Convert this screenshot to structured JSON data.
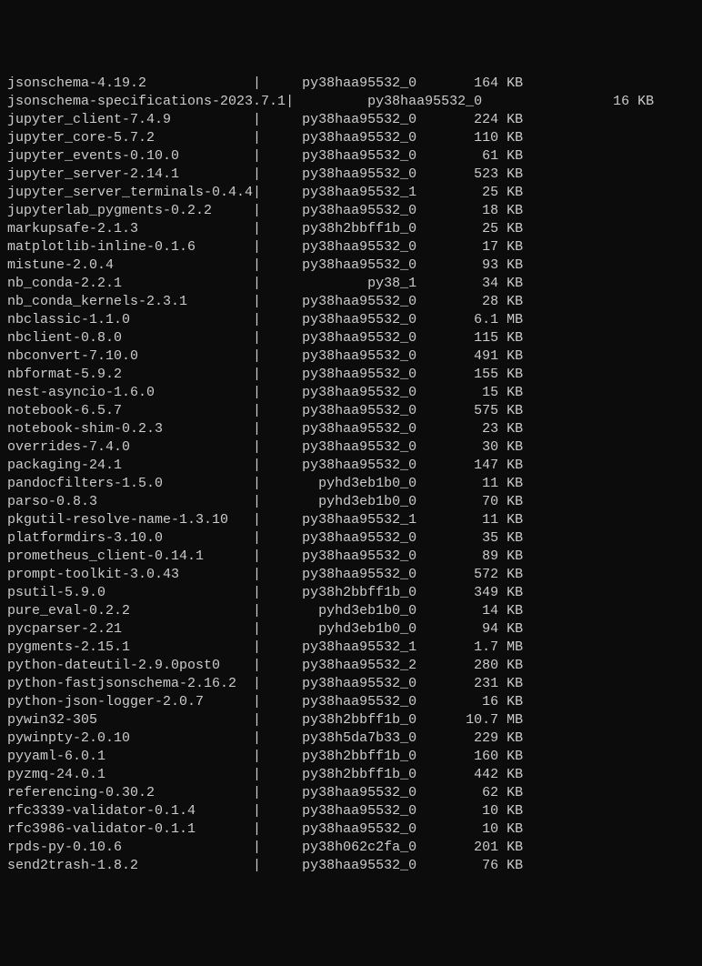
{
  "packages": [
    {
      "name": "jsonschema-4.19.2",
      "separator": "|",
      "build": "py38haa95532_0",
      "size": "164 KB"
    },
    {
      "name": "jsonschema-specifications-2023.7.1",
      "separator": "|",
      "build": "py38haa95532_0",
      "size": "16 KB"
    },
    {
      "name": "jupyter_client-7.4.9",
      "separator": "|",
      "build": "py38haa95532_0",
      "size": "224 KB"
    },
    {
      "name": "jupyter_core-5.7.2",
      "separator": "|",
      "build": "py38haa95532_0",
      "size": "110 KB"
    },
    {
      "name": "jupyter_events-0.10.0",
      "separator": "|",
      "build": "py38haa95532_0",
      "size": "61 KB"
    },
    {
      "name": "jupyter_server-2.14.1",
      "separator": "|",
      "build": "py38haa95532_0",
      "size": "523 KB"
    },
    {
      "name": "jupyter_server_terminals-0.4.4",
      "separator": "|",
      "build": "py38haa95532_1",
      "size": "25 KB"
    },
    {
      "name": "jupyterlab_pygments-0.2.2",
      "separator": "|",
      "build": "py38haa95532_0",
      "size": "18 KB"
    },
    {
      "name": "markupsafe-2.1.3",
      "separator": "|",
      "build": "py38h2bbff1b_0",
      "size": "25 KB"
    },
    {
      "name": "matplotlib-inline-0.1.6",
      "separator": "|",
      "build": "py38haa95532_0",
      "size": "17 KB"
    },
    {
      "name": "mistune-2.0.4",
      "separator": "|",
      "build": "py38haa95532_0",
      "size": "93 KB"
    },
    {
      "name": "nb_conda-2.2.1",
      "separator": "|",
      "build": "py38_1",
      "size": "34 KB"
    },
    {
      "name": "nb_conda_kernels-2.3.1",
      "separator": "|",
      "build": "py38haa95532_0",
      "size": "28 KB"
    },
    {
      "name": "nbclassic-1.1.0",
      "separator": "|",
      "build": "py38haa95532_0",
      "size": "6.1 MB"
    },
    {
      "name": "nbclient-0.8.0",
      "separator": "|",
      "build": "py38haa95532_0",
      "size": "115 KB"
    },
    {
      "name": "nbconvert-7.10.0",
      "separator": "|",
      "build": "py38haa95532_0",
      "size": "491 KB"
    },
    {
      "name": "nbformat-5.9.2",
      "separator": "|",
      "build": "py38haa95532_0",
      "size": "155 KB"
    },
    {
      "name": "nest-asyncio-1.6.0",
      "separator": "|",
      "build": "py38haa95532_0",
      "size": "15 KB"
    },
    {
      "name": "notebook-6.5.7",
      "separator": "|",
      "build": "py38haa95532_0",
      "size": "575 KB"
    },
    {
      "name": "notebook-shim-0.2.3",
      "separator": "|",
      "build": "py38haa95532_0",
      "size": "23 KB"
    },
    {
      "name": "overrides-7.4.0",
      "separator": "|",
      "build": "py38haa95532_0",
      "size": "30 KB"
    },
    {
      "name": "packaging-24.1",
      "separator": "|",
      "build": "py38haa95532_0",
      "size": "147 KB"
    },
    {
      "name": "pandocfilters-1.5.0",
      "separator": "|",
      "build": "pyhd3eb1b0_0",
      "size": "11 KB"
    },
    {
      "name": "parso-0.8.3",
      "separator": "|",
      "build": "pyhd3eb1b0_0",
      "size": "70 KB"
    },
    {
      "name": "pkgutil-resolve-name-1.3.10",
      "separator": "|",
      "build": "py38haa95532_1",
      "size": "11 KB"
    },
    {
      "name": "platformdirs-3.10.0",
      "separator": "|",
      "build": "py38haa95532_0",
      "size": "35 KB"
    },
    {
      "name": "prometheus_client-0.14.1",
      "separator": "|",
      "build": "py38haa95532_0",
      "size": "89 KB"
    },
    {
      "name": "prompt-toolkit-3.0.43",
      "separator": "|",
      "build": "py38haa95532_0",
      "size": "572 KB"
    },
    {
      "name": "psutil-5.9.0",
      "separator": "|",
      "build": "py38h2bbff1b_0",
      "size": "349 KB"
    },
    {
      "name": "pure_eval-0.2.2",
      "separator": "|",
      "build": "pyhd3eb1b0_0",
      "size": "14 KB"
    },
    {
      "name": "pycparser-2.21",
      "separator": "|",
      "build": "pyhd3eb1b0_0",
      "size": "94 KB"
    },
    {
      "name": "pygments-2.15.1",
      "separator": "|",
      "build": "py38haa95532_1",
      "size": "1.7 MB"
    },
    {
      "name": "python-dateutil-2.9.0post0",
      "separator": "|",
      "build": "py38haa95532_2",
      "size": "280 KB"
    },
    {
      "name": "python-fastjsonschema-2.16.2",
      "separator": "|",
      "build": "py38haa95532_0",
      "size": "231 KB"
    },
    {
      "name": "python-json-logger-2.0.7",
      "separator": "|",
      "build": "py38haa95532_0",
      "size": "16 KB"
    },
    {
      "name": "pywin32-305",
      "separator": "|",
      "build": "py38h2bbff1b_0",
      "size": "10.7 MB"
    },
    {
      "name": "pywinpty-2.0.10",
      "separator": "|",
      "build": "py38h5da7b33_0",
      "size": "229 KB"
    },
    {
      "name": "pyyaml-6.0.1",
      "separator": "|",
      "build": "py38h2bbff1b_0",
      "size": "160 KB"
    },
    {
      "name": "pyzmq-24.0.1",
      "separator": "|",
      "build": "py38h2bbff1b_0",
      "size": "442 KB"
    },
    {
      "name": "referencing-0.30.2",
      "separator": "|",
      "build": "py38haa95532_0",
      "size": "62 KB"
    },
    {
      "name": "rfc3339-validator-0.1.4",
      "separator": "|",
      "build": "py38haa95532_0",
      "size": "10 KB"
    },
    {
      "name": "rfc3986-validator-0.1.1",
      "separator": "|",
      "build": "py38haa95532_0",
      "size": "10 KB"
    },
    {
      "name": "rpds-py-0.10.6",
      "separator": "|",
      "build": "py38h062c2fa_0",
      "size": "201 KB"
    },
    {
      "name": "send2trash-1.8.2",
      "separator": "|",
      "build": "py38haa95532_0",
      "size": "76 KB"
    }
  ],
  "columns": {
    "name_width": 30,
    "sep_width": 1,
    "build_width": 19,
    "size_width": 13
  }
}
